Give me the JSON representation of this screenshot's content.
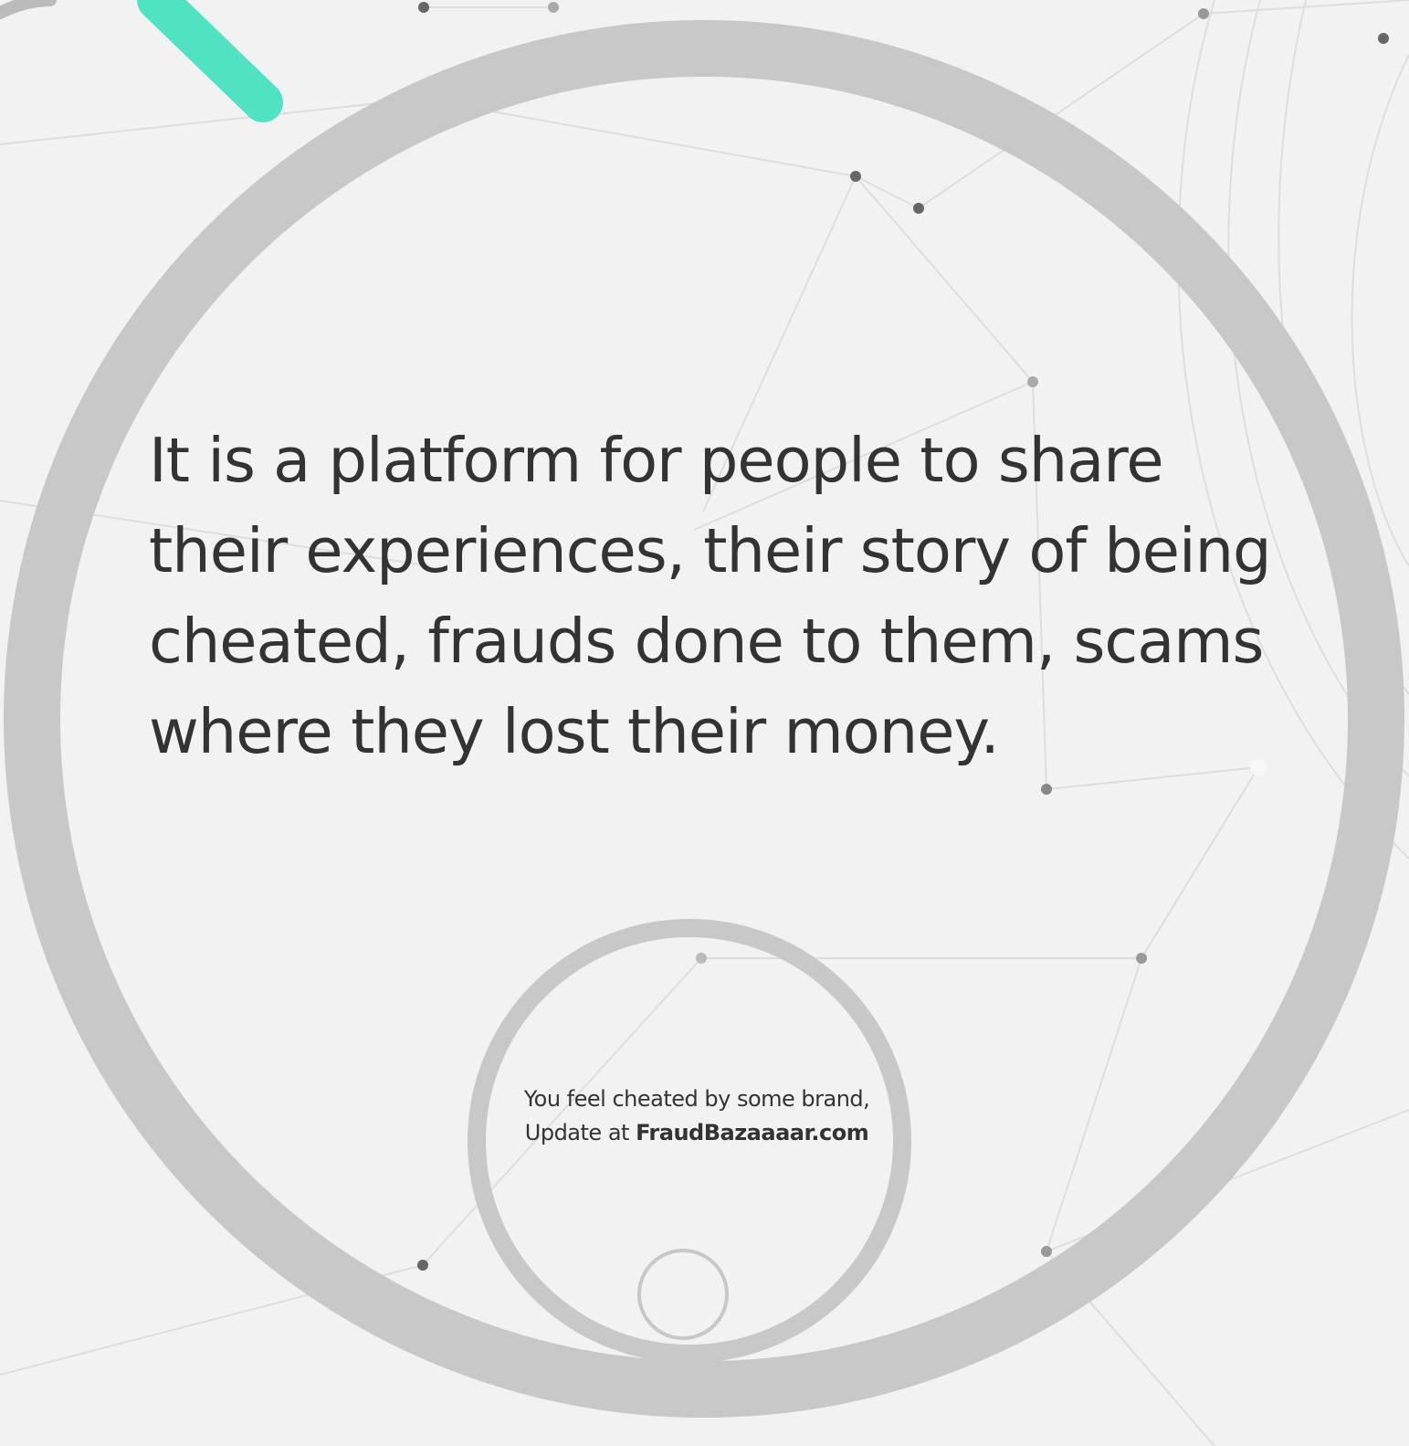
{
  "main": {
    "text": "It is a  platform for people to share their experiences, their story of being cheated, frauds done to them, scams where they lost their money."
  },
  "inner_circle": {
    "line1": "You feel cheated by some brand,",
    "line2_prefix": "Update at ",
    "line2_brand": "FraudBazaaaar.com"
  },
  "colors": {
    "background": "#f2f2f2",
    "ring": "#c8c8c8",
    "accent": "#4fe3c1",
    "text": "#333333",
    "network_line": "#dcdcdc",
    "network_node": "#666666"
  }
}
